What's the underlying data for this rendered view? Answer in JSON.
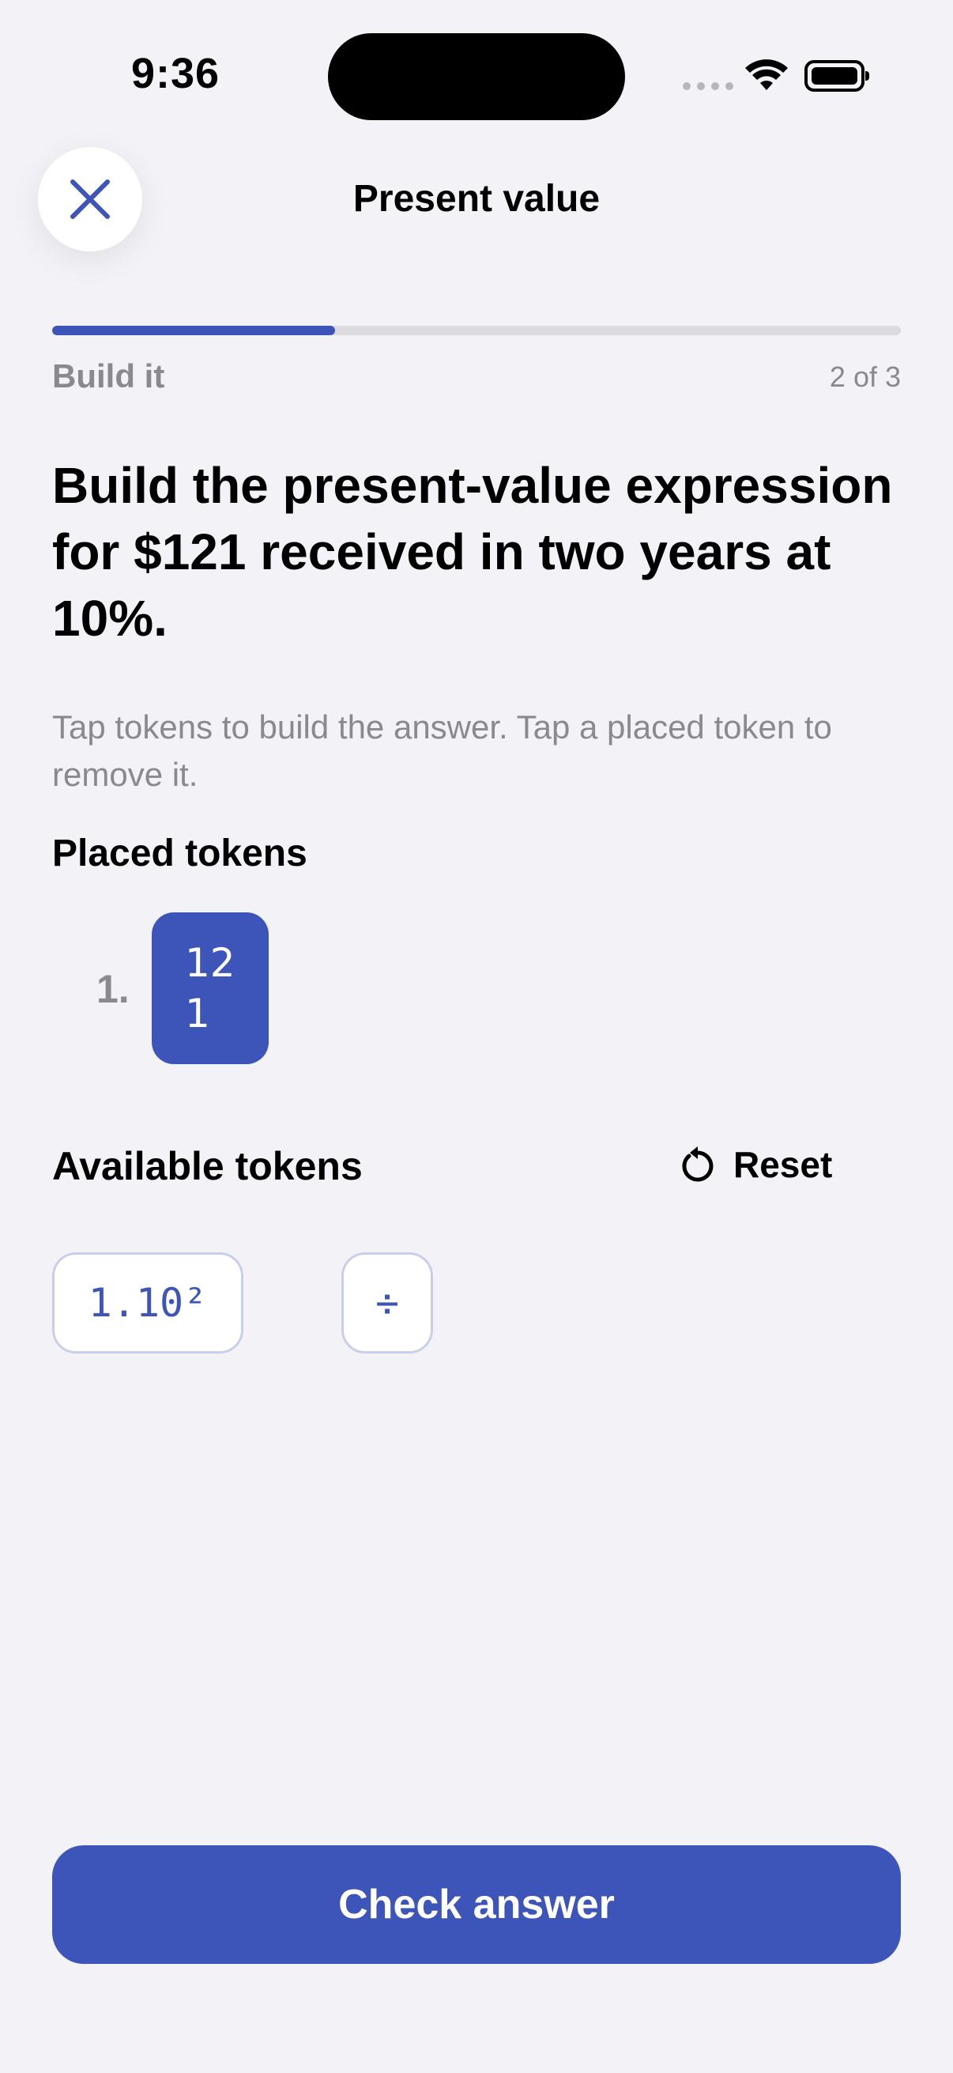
{
  "status_bar": {
    "time": "9:36"
  },
  "header": {
    "title": "Present value",
    "close_icon": "close-icon"
  },
  "progress": {
    "step_label": "Build it",
    "step_count": "2 of 3",
    "fraction": 0.333
  },
  "question": {
    "text": "Build the present-value expression for $121 received in two years at 10%.",
    "instructions": "Tap tokens to build the answer. Tap a placed token to remove it."
  },
  "placed": {
    "heading": "Placed tokens",
    "items": [
      {
        "index": "1.",
        "value": "121"
      }
    ]
  },
  "available": {
    "heading": "Available tokens",
    "reset_label": "Reset",
    "tokens": [
      {
        "value": "1.10²"
      },
      {
        "value": "÷"
      }
    ]
  },
  "footer": {
    "check_label": "Check answer"
  },
  "colors": {
    "accent": "#3d55b8",
    "background": "#f2f2f7",
    "muted": "#8a8a8e"
  }
}
